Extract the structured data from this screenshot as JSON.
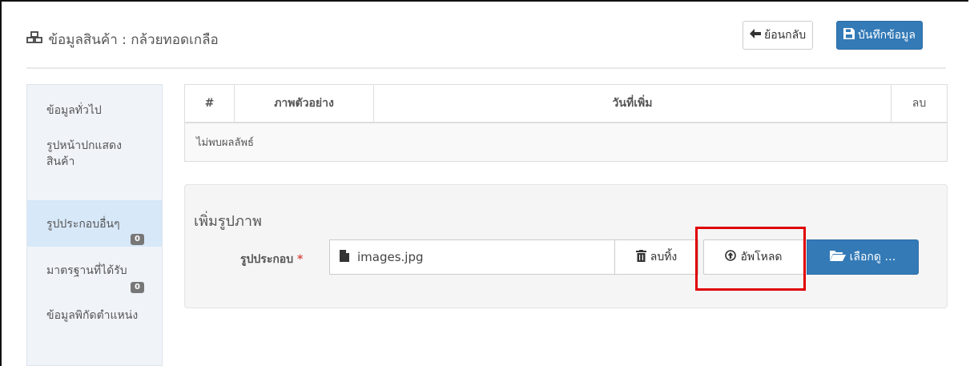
{
  "header": {
    "title": "ข้อมูลสินค้า : กล้วยทอดเกลือ",
    "title_icon": "cubes-icon",
    "back_label": "ย้อนกลับ",
    "save_label": "บันทึกข้อมูล"
  },
  "sidebar": {
    "items": [
      {
        "label": "ข้อมูลทั่วไป"
      },
      {
        "label": "รูปหน้าปกแสดงสินค้า"
      },
      {
        "label": "รูปประกอบอื่นๆ",
        "badge": "0"
      },
      {
        "label": "มาตรฐานที่ได้รับ",
        "badge": "0"
      },
      {
        "label": "ข้อมูลพิกัดตำแหน่ง"
      }
    ],
    "active_index": 2
  },
  "table": {
    "columns": [
      "#",
      "ภาพตัวอย่าง",
      "วันที่เพิ่ม",
      "ลบ"
    ],
    "empty_text": "ไม่พบผลลัพธ์"
  },
  "upload": {
    "panel_title": "เพิ่มรูปภาพ",
    "field_label": "รูปประกอบ",
    "required_mark": "*",
    "file_name": "images.jpg",
    "remove_label": "ลบทิ้ง",
    "upload_label": "อัพโหลด",
    "browse_label": "เลือกดู …"
  },
  "colors": {
    "primary": "#337ab7",
    "highlight": "#e00000",
    "required": "#d9534f",
    "sidebar_bg": "#f0f4f9",
    "sidebar_active": "#d7e8f8"
  }
}
